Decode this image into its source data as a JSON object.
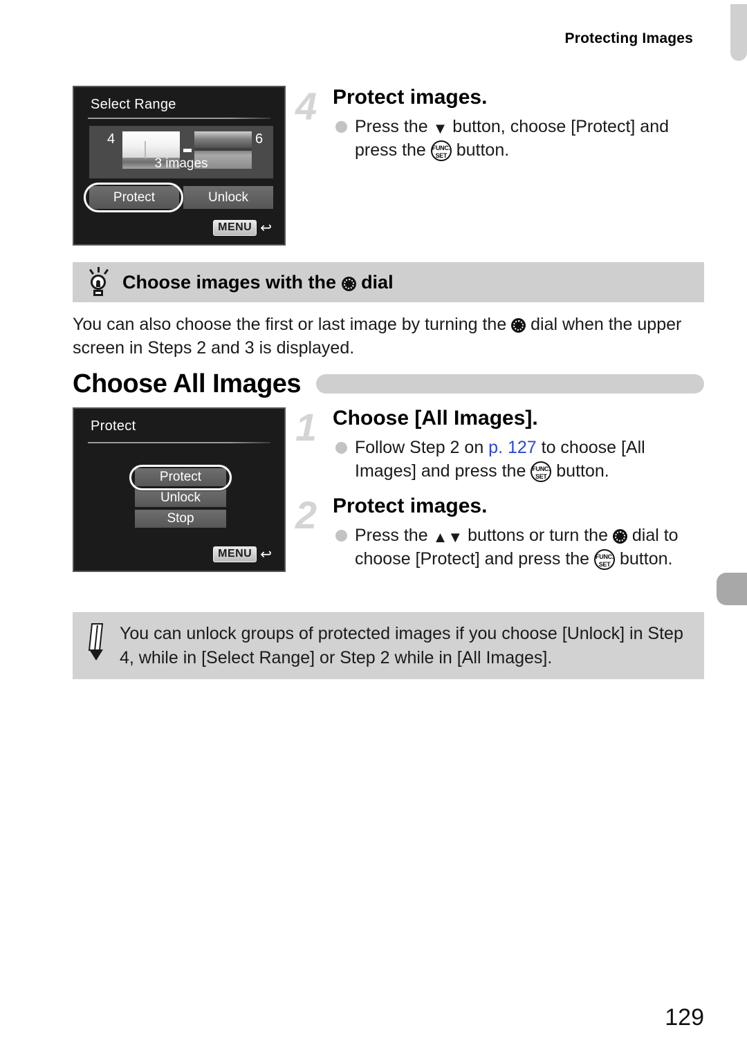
{
  "header": {
    "running_title": "Protecting Images"
  },
  "page_number": "129",
  "screens": {
    "select_range": {
      "title": "Select Range",
      "first_index": "4",
      "last_index": "6",
      "count_label": "3 images",
      "options": [
        "Protect",
        "Unlock"
      ],
      "selected_option": "Protect",
      "menu_key": "MENU"
    },
    "protect_menu": {
      "title": "Protect",
      "items": [
        "Protect",
        "Unlock",
        "Stop"
      ],
      "selected_item": "Protect",
      "menu_key": "MENU"
    }
  },
  "steps_select_range": [
    {
      "number": "4",
      "title": "Protect images.",
      "body_parts": [
        "Press the ",
        " button, choose [Protect] and press the ",
        " button."
      ]
    }
  ],
  "tip": {
    "title_before": "Choose images with the ",
    "title_after": " dial",
    "text_before": "You can also choose the first or last image by turning the ",
    "text_after": " dial when the upper screen in Steps 2 and 3 is displayed."
  },
  "section": {
    "title": "Choose All Images"
  },
  "steps_all_images": [
    {
      "number": "1",
      "title": "Choose [All Images].",
      "body_pre": "Follow Step 2 on ",
      "body_link": "p. 127",
      "body_mid": " to choose [All Images] and press the ",
      "body_end": " button."
    },
    {
      "number": "2",
      "title": "Protect images.",
      "body_pre": "Press the ",
      "body_mid": " buttons or turn the ",
      "body_mid2": " dial to choose [Protect] and press the ",
      "body_end": " button."
    }
  ],
  "note": {
    "text": "You can unlock groups of protected images if you choose [Unlock] in Step 4, while in [Select Range] or Step 2 while in [All Images]."
  },
  "icons": {
    "func_set_top": "FUNC.",
    "func_set_bottom": "SET",
    "down_triangle": "▼",
    "up_triangle": "▲",
    "return_arrow": "↰"
  },
  "colors": {
    "link": "#2b46d8",
    "tip_header": "#cfcfcf",
    "note_bg": "#d2d2d2",
    "step_number": "#d4d4d4"
  }
}
